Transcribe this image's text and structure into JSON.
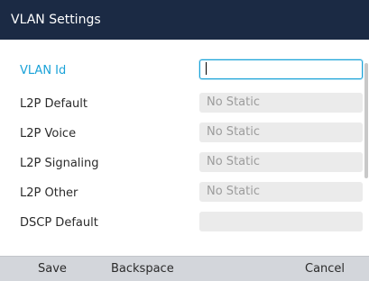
{
  "window": {
    "title": "VLAN Settings"
  },
  "rows": [
    {
      "label": "VLAN Id",
      "value": ""
    },
    {
      "label": "L2P Default",
      "value": "No Static"
    },
    {
      "label": "L2P Voice",
      "value": "No Static"
    },
    {
      "label": "L2P Signaling",
      "value": "No Static"
    },
    {
      "label": "L2P Other",
      "value": "No Static"
    },
    {
      "label": "DSCP Default",
      "value": ""
    }
  ],
  "softkeys": {
    "save": "Save",
    "backspace": "Backspace",
    "cancel": "Cancel"
  },
  "colors": {
    "titlebar": "#1b2a44",
    "accent": "#1aa2d8",
    "softkey_bar": "#d3d6db"
  }
}
